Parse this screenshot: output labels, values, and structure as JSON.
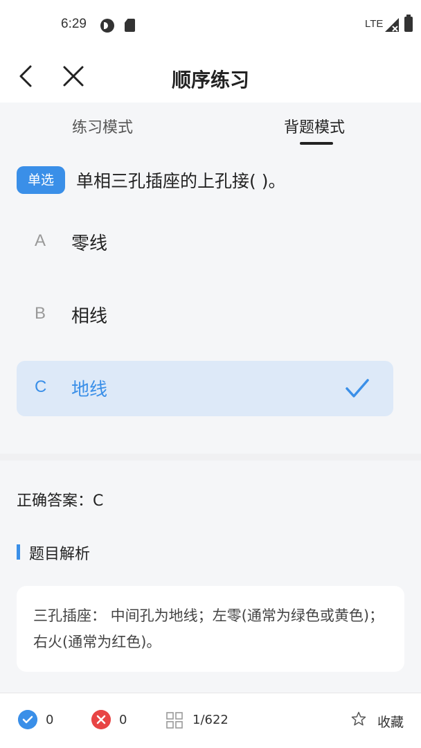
{
  "status_bar": {
    "time": "6:29",
    "network": "LTE"
  },
  "nav": {
    "title": "顺序练习",
    "back_icon": "chevron-left-icon",
    "close_icon": "close-icon"
  },
  "tabs": [
    {
      "label": "练习模式",
      "active": false
    },
    {
      "label": "背题模式",
      "active": true
    }
  ],
  "question": {
    "type_badge": "单选",
    "text": "单相三孔插座的上孔接( )。",
    "options": [
      {
        "letter": "A",
        "text": "零线",
        "selected": false
      },
      {
        "letter": "B",
        "text": "相线",
        "selected": false
      },
      {
        "letter": "C",
        "text": "地线",
        "selected": true
      }
    ]
  },
  "answer": {
    "line": "正确答案：C"
  },
  "analysis": {
    "title": "题目解析",
    "text": "三孔插座： 中间孔为地线；左零(通常为绿色或黄色)；右火(通常为红色)。"
  },
  "bottom": {
    "correct_count": "0",
    "wrong_count": "0",
    "progress": "1/622",
    "favorite_label": "收藏"
  },
  "colors": {
    "accent": "#3a8fe8",
    "selected_bg": "#dde9f8",
    "wrong": "#e84545"
  }
}
